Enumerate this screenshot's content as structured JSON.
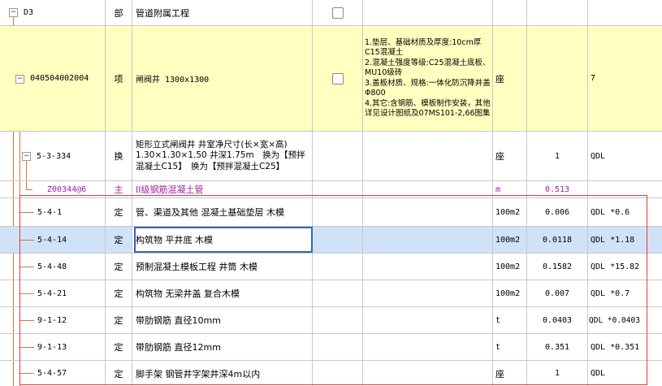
{
  "rows": [
    {
      "code": "D3",
      "type": "部",
      "name": "管道附属工程",
      "desc": "",
      "unit": "",
      "qty": "",
      "expr": ""
    },
    {
      "code": "040504002004",
      "type": "项",
      "name": "闸阀井 1300x1300",
      "desc": "1.垫层、基础材质及厚度:10cm厚C15混凝土\n2.混凝土强度等级:C25混凝土底板、MU10级砖\n3.盖板材质、规格:一体化防沉降井盖Φ800\n4.其它:含钢筋、模板制作安装，其他详见设计图纸及07MS101-2,66图集",
      "unit": "座",
      "qty": "",
      "expr": "7"
    },
    {
      "code": "5-3-334",
      "type": "换",
      "name": "矩形立式闸阀井 井室净尺寸(长×宽×高) 1.30×1.30×1.50 井深1.75m　换为【预拌混凝土C15】　换为【预拌混凝土C25】",
      "desc": "",
      "unit": "座",
      "qty": "1",
      "expr": "QDL"
    },
    {
      "code": "Z00344@6",
      "type": "主",
      "name": "II级钢筋混凝土管",
      "desc": "",
      "unit": "m",
      "qty": "0.513",
      "expr": ""
    },
    {
      "code": "5-4-1",
      "type": "定",
      "name": "管、渠道及其他 混凝土基础垫层 木模",
      "desc": "",
      "unit": "100m2",
      "qty": "0.006",
      "expr": "QDL *0.6"
    },
    {
      "code": "5-4-14",
      "type": "定",
      "name": "构筑物 平井底 木模",
      "desc": "",
      "unit": "100m2",
      "qty": "0.0118",
      "expr": "QDL *1.18"
    },
    {
      "code": "5-4-48",
      "type": "定",
      "name": "预制混凝土模板工程 井筒 木模",
      "desc": "",
      "unit": "100m2",
      "qty": "0.1582",
      "expr": "QDL *15.82"
    },
    {
      "code": "5-4-21",
      "type": "定",
      "name": "构筑物 无梁井盖 复合木模",
      "desc": "",
      "unit": "100m2",
      "qty": "0.007",
      "expr": "QDL *0.7"
    },
    {
      "code": "9-1-12",
      "type": "定",
      "name": "带肋钢筋 直径10mm",
      "desc": "",
      "unit": "t",
      "qty": "0.0403",
      "expr": "QDL *0.0403"
    },
    {
      "code": "9-1-13",
      "type": "定",
      "name": "带肋钢筋 直径12mm",
      "desc": "",
      "unit": "t",
      "qty": "0.351",
      "expr": "QDL *0.351"
    },
    {
      "code": "5-4-57",
      "type": "定",
      "name": "脚手架 钢管井字架井深4m以内",
      "desc": "",
      "unit": "座",
      "qty": "1",
      "expr": "QDL"
    }
  ],
  "toggles": {
    "collapse": "−"
  },
  "colors": {
    "item_row": "#ffffc0",
    "selected_row": "#cfe2f7",
    "main_material_text": "#a020a0",
    "highlight_box": "#e53935",
    "tree_line": "#d9733d",
    "edit_border": "#2f66b9"
  }
}
